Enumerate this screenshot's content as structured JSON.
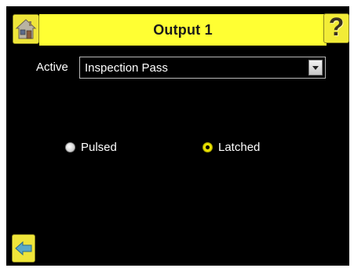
{
  "header": {
    "title": "Output 1",
    "home_icon": "home-icon",
    "help_icon": "help-icon",
    "help_glyph": "?"
  },
  "active": {
    "label": "Active",
    "selected_value": "Inspection Pass",
    "dropdown_icon": "chevron-down-icon"
  },
  "mode": {
    "options": [
      {
        "label": "Pulsed",
        "selected": false
      },
      {
        "label": "Latched",
        "selected": true
      }
    ]
  },
  "footer": {
    "back_icon": "back-arrow-icon"
  },
  "colors": {
    "accent": "#ffff33",
    "background": "#000000",
    "text": "#ffffff",
    "radio_selected": "#e8e000"
  }
}
